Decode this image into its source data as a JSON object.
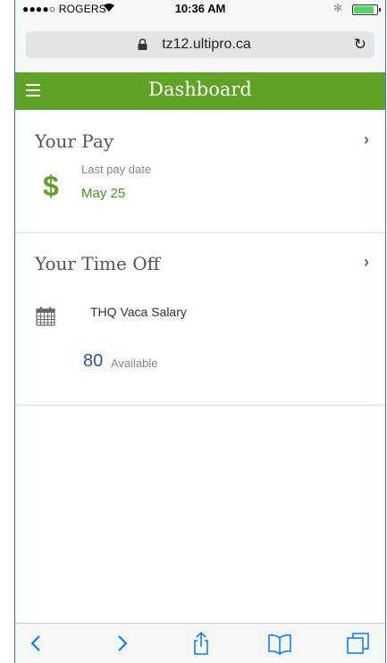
{
  "status_bar": {
    "carrier": "●●●●○ ROGERS",
    "time": "10:36 AM",
    "bluetooth": "✻"
  },
  "browser": {
    "url": "tz12.ultipro.ca",
    "reload_glyph": "↻"
  },
  "header": {
    "title": "Dashboard"
  },
  "pay": {
    "title": "Your Pay",
    "label": "Last pay date",
    "value": "May 25",
    "icon_glyph": "$"
  },
  "time_off": {
    "title": "Your Time Off",
    "plan_name": "THQ Vaca Salary",
    "balance": "80",
    "balance_label": "Available"
  },
  "chevron": "›",
  "colors": {
    "header_green": "#5fa324",
    "ios_blue": "#007aff"
  },
  "icons": [
    "menu-icon",
    "lock-icon",
    "reload-icon",
    "dollar-icon",
    "calendar-icon",
    "back-icon",
    "forward-icon",
    "share-icon",
    "bookmarks-icon",
    "tabs-icon"
  ]
}
